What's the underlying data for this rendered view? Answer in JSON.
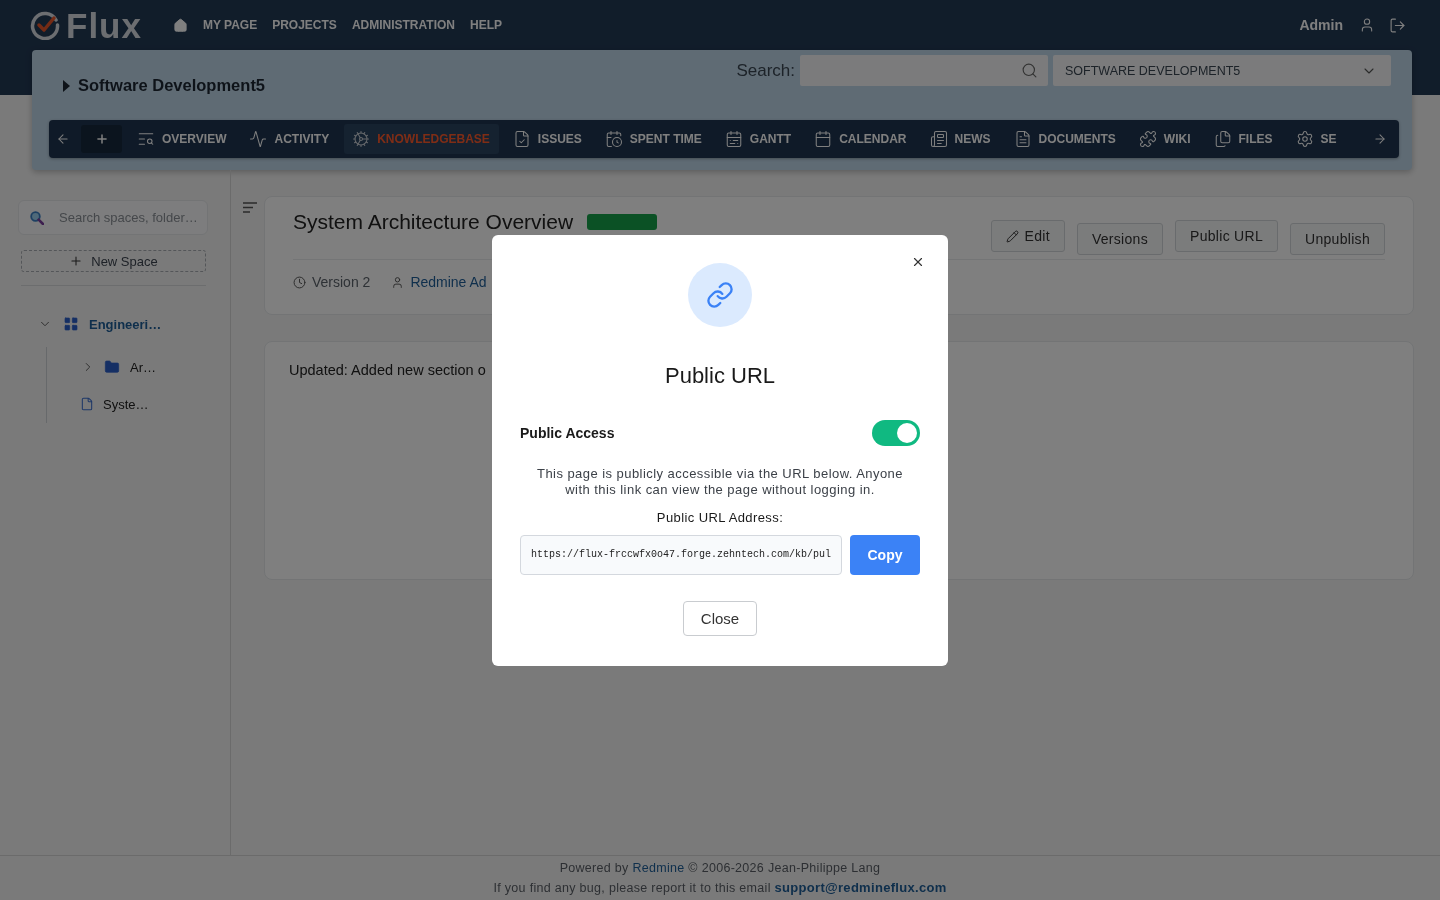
{
  "header": {
    "logo_text": "Flux",
    "nav": [
      "MY PAGE",
      "PROJECTS",
      "ADMINISTRATION",
      "HELP"
    ],
    "user": "Admin"
  },
  "project_panel": {
    "project_name": "Software Development5",
    "search_label": "Search:",
    "project_select": "SOFTWARE DEVELOPMENT5",
    "menu": [
      {
        "label": "OVERVIEW",
        "selected": false
      },
      {
        "label": "ACTIVITY",
        "selected": false
      },
      {
        "label": "KNOWLEDGEBASE",
        "selected": true
      },
      {
        "label": "ISSUES",
        "selected": false
      },
      {
        "label": "SPENT TIME",
        "selected": false
      },
      {
        "label": "GANTT",
        "selected": false
      },
      {
        "label": "CALENDAR",
        "selected": false
      },
      {
        "label": "NEWS",
        "selected": false
      },
      {
        "label": "DOCUMENTS",
        "selected": false
      },
      {
        "label": "WIKI",
        "selected": false
      },
      {
        "label": "FILES",
        "selected": false
      },
      {
        "label": "SE",
        "selected": false
      }
    ]
  },
  "sidebar": {
    "search": {
      "placeholder": "Search spaces, folder…"
    },
    "new_space": "New Space",
    "tree": [
      {
        "label": "Engineeri…",
        "kind": "space",
        "expanded": true,
        "children": [
          {
            "label": "Ar…",
            "kind": "folder",
            "expanded": false
          },
          {
            "label": "Syste…",
            "kind": "page"
          }
        ]
      }
    ]
  },
  "page": {
    "title": "System Architecture Overview",
    "published": true,
    "actions": [
      {
        "label": "Edit",
        "kind": "edit"
      },
      {
        "label": "Versions",
        "kind": "plain"
      },
      {
        "label": "Public URL",
        "kind": "plain"
      },
      {
        "label": "Unpublish",
        "kind": "plain"
      }
    ],
    "meta": {
      "version": "Version 2",
      "author": "Redmine Ad"
    },
    "content": "Updated: Added new section o"
  },
  "modal": {
    "title": "Public URL",
    "public_access": {
      "label": "Public Access",
      "on": true
    },
    "description": "This page is publicly accessible via the URL below. Anyone with this link can view the page without logging in.",
    "url_label": "Public URL Address:",
    "url": {
      "value": "https://flux-frccwfx0o47.forge.zehntech.com/kb/pul"
    },
    "copy_button": "Copy",
    "close_button": "Close"
  },
  "footer": {
    "credit": {
      "prefix": "Powered by",
      "link": "Redmine",
      "suffix": "© 2006-2026 Jean-Philippe Lang"
    },
    "report": {
      "text": "If you find any bug, please report it to this email",
      "email": "support@redmineflux.com"
    }
  }
}
